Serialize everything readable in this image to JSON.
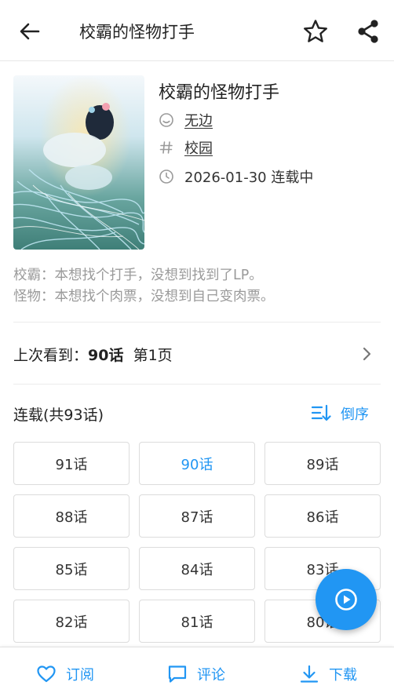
{
  "header": {
    "title": "校霸的怪物打手",
    "back_icon": "arrow-back-icon",
    "favorite_icon": "star-outline-icon",
    "share_icon": "share-icon"
  },
  "comic": {
    "title": "校霸的怪物打手",
    "author": "无边",
    "tag": "校园",
    "update_date": "2026-01-30 连载中",
    "description_lines": [
      "校霸：本想找个打手，没想到找到了LP。",
      "怪物：本想找个肉票，没想到自己变肉票。"
    ]
  },
  "history": {
    "prefix": "上次看到：",
    "chapter": "90话",
    "page": "第1页"
  },
  "chapters": {
    "heading": "连载(共93话)",
    "sort_label": "倒序",
    "current": "90话",
    "items": [
      "91话",
      "90话",
      "89话",
      "88话",
      "87话",
      "86话",
      "85话",
      "84话",
      "83话",
      "82话",
      "81话",
      "80话"
    ]
  },
  "bottom_bar": {
    "subscribe": "订阅",
    "comment": "评论",
    "download": "下载"
  },
  "colors": {
    "accent": "#2196f3",
    "muted_text": "#9a9a9a"
  }
}
